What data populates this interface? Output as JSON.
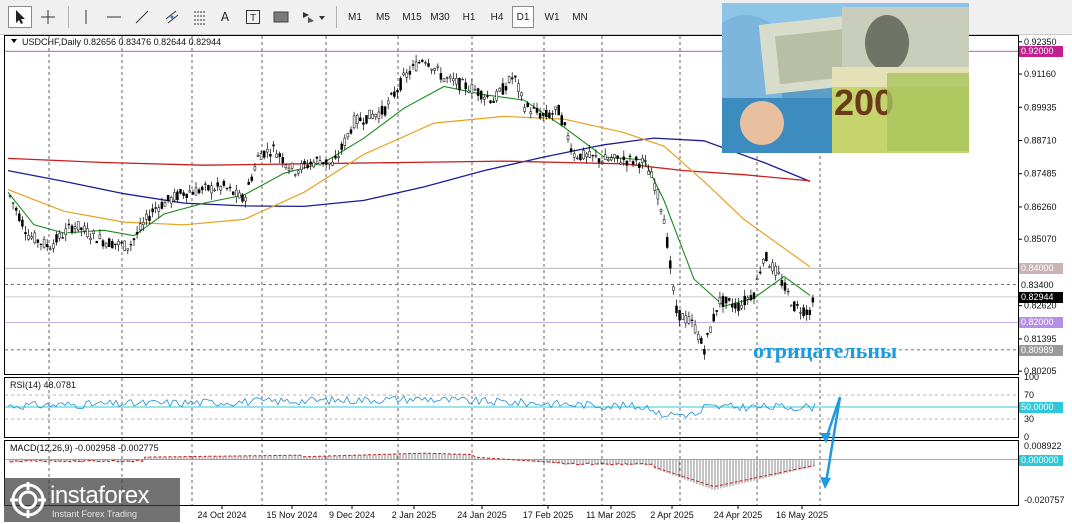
{
  "toolbar": {
    "tools": [
      {
        "icon": "cursor-icon"
      },
      {
        "icon": "crosshair-icon"
      },
      {
        "icon": "vertical-line-icon"
      },
      {
        "icon": "horizontal-line-icon"
      },
      {
        "icon": "trendline-icon"
      },
      {
        "icon": "channel-icon"
      },
      {
        "icon": "fibonacci-icon"
      },
      {
        "icon": "text-icon"
      },
      {
        "icon": "text-label-icon"
      },
      {
        "icon": "rectangle-icon"
      },
      {
        "icon": "shapes-menu-icon"
      }
    ],
    "timeframes": [
      "M1",
      "M5",
      "M15",
      "M30",
      "H1",
      "H4",
      "D1",
      "W1",
      "MN"
    ],
    "selected_timeframe": "D1"
  },
  "main": {
    "symbol_line": "USDCHF,Daily  0.82656 0.83476 0.82644 0.82944",
    "price_labels": [
      "0.92350",
      "0.91160",
      "0.89935",
      "0.88710",
      "0.87485",
      "0.86260",
      "0.85070",
      "0.82620",
      "0.81395",
      "0.80205"
    ],
    "badges": [
      {
        "text": "0.92000",
        "bg": "#c21f8f",
        "fg": "#ffffff",
        "level": 0.92
      },
      {
        "text": "0.84000",
        "bg": "#c8b4b4",
        "fg": "#ffffff",
        "level": 0.84
      },
      {
        "text": "0.83400",
        "bg": "#ffffff",
        "fg": "#111111",
        "level": 0.834
      },
      {
        "text": "0.82944",
        "bg": "#000000",
        "fg": "#ffffff",
        "level": 0.82944
      },
      {
        "text": "0.82000",
        "bg": "#b690e6",
        "fg": "#ffffff",
        "level": 0.82
      },
      {
        "text": "0.80989",
        "bg": "#9a9a9a",
        "fg": "#ffffff",
        "level": 0.80989
      }
    ],
    "dates": [
      "24 Oct 2024",
      "15 Nov 2024",
      "9 Dec 2024",
      "2 Jan 2025",
      "24 Jan 2025",
      "17 Feb 2025",
      "11 Mar 2025",
      "2 Apr 2025",
      "24 Apr 2025",
      "16 May 2025"
    ]
  },
  "rsi": {
    "label": "RSI(14) 48.0781",
    "levels": [
      "100",
      "70",
      "50.0000",
      "30",
      "0"
    ]
  },
  "macd": {
    "label": "MACD(12,26,9) -0.002958 -0.002775",
    "levels": [
      "0.008922",
      "0.000000",
      "-0.020757"
    ]
  },
  "annotation": "отрицательны",
  "watermark": {
    "brand": "instaforex",
    "tagline": "Instant Forex Trading"
  },
  "colors": {
    "bull_candle": "#00000000",
    "candle": "#000000",
    "ma_fast": "#1a8a1a",
    "ma_mid": "#e8a020",
    "ma_slow_red": "#c81e1e",
    "ma_slow_blue": "#1c1c9a",
    "rsi_line": "#1e8fd8",
    "macd_signal": "#c81e1e",
    "highlight_cyan": "#30c8d8",
    "annotation": "#1e9be0"
  }
}
